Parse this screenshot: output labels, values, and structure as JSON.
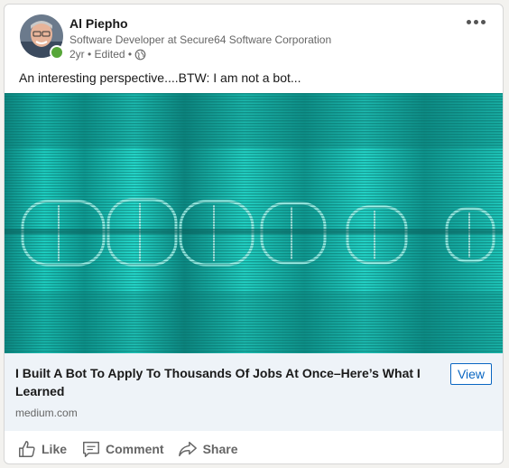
{
  "post": {
    "author_name": "Al Piepho",
    "author_headline": "Software Developer at Secure64 Software Corporation",
    "meta": "2yr • Edited •",
    "commentary": "An interesting perspective....BTW: I am not a bot...",
    "more_icon": "more-icon",
    "visibility_icon": "globe-icon"
  },
  "article": {
    "title": "I Built A Bot To Apply To Thousands Of Jobs At Once–Here’s What I Learned",
    "source": "medium.com",
    "view_label": "View"
  },
  "actions": [
    {
      "label": "Like",
      "icon": "like-icon"
    },
    {
      "label": "Comment",
      "icon": "comment-icon"
    },
    {
      "label": "Share",
      "icon": "share-icon"
    }
  ],
  "colors": {
    "accent": "#0a66c2",
    "presence": "#57a639",
    "image_tint": "#1fd6c8"
  }
}
